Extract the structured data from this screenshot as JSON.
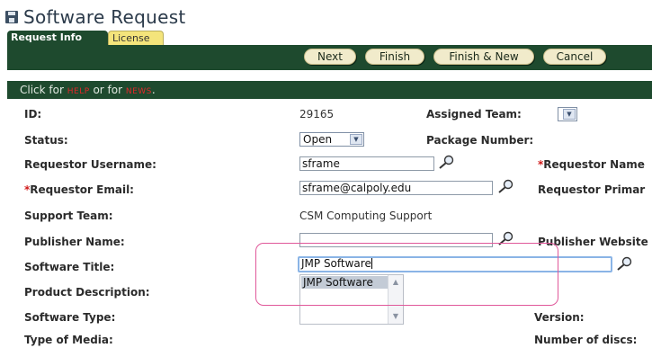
{
  "window": {
    "title": "Software Request"
  },
  "tabs": [
    {
      "label": "Request Info"
    },
    {
      "label": "License"
    }
  ],
  "toolbar": {
    "next": "Next",
    "finish": "Finish",
    "finish_new": "Finish & New",
    "cancel": "Cancel"
  },
  "help_bar": {
    "prefix": "Click for ",
    "help": "HELP",
    "mid": " or for ",
    "news": "NEWS",
    "suffix": "."
  },
  "form": {
    "id_label": "ID:",
    "id_value": "29165",
    "assigned_team_label": "Assigned Team:",
    "status_label": "Status:",
    "status_value": "Open",
    "package_number_label": "Package Number:",
    "requestor_username_label": "Requestor Username:",
    "requestor_username_value": "sframe",
    "requestor_name_label": "Requestor Name",
    "requestor_email_label": "Requestor Email:",
    "requestor_email_value": "sframe@calpoly.edu",
    "requestor_primary_label": "Requestor Primar",
    "support_team_label": "Support Team:",
    "support_team_value": "CSM Computing Support",
    "publisher_name_label": "Publisher Name:",
    "publisher_name_value": "",
    "publisher_website_label": "Publisher Website",
    "software_title_label": "Software Title:",
    "software_title_value": "JMP Software",
    "product_description_label": "Product Description:",
    "software_type_label": "Software Type:",
    "version_label": "Version:",
    "type_of_media_label": "Type of Media:",
    "number_of_discs_label": "Number of discs:",
    "required_marker": "*"
  },
  "autocomplete": {
    "items": [
      "JMP Software"
    ]
  },
  "icons": {
    "floppy": "floppy-disk-icon",
    "magnifier": "magnifier-icon",
    "dropdown": "chevron-down-icon"
  },
  "colors": {
    "header_bg": "#1e4a2e",
    "button_bg": "#f1ebcb",
    "required": "#d01818",
    "help_link": "#e0282a",
    "highlight": "#e0589a"
  }
}
